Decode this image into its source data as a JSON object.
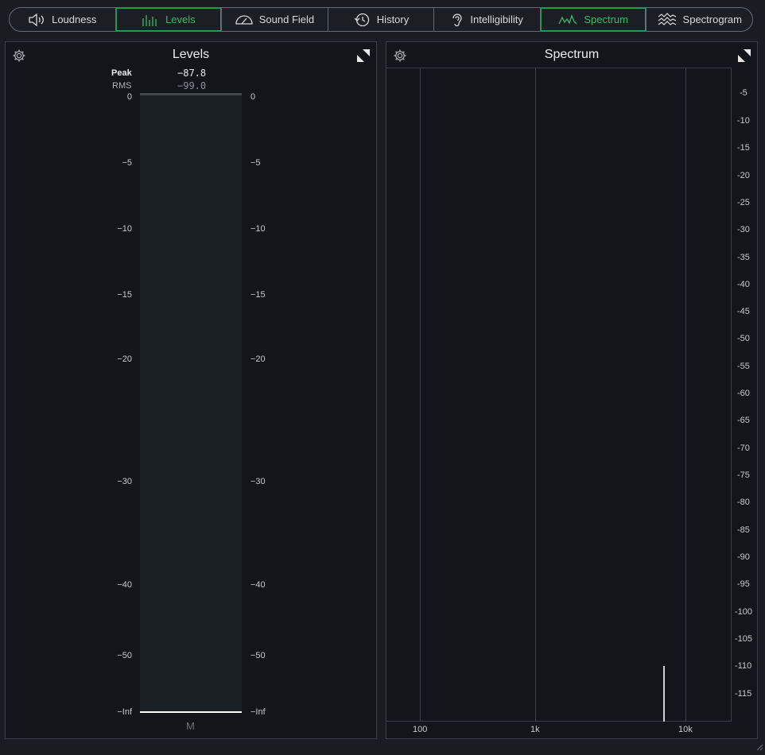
{
  "tabs": [
    {
      "label": "Loudness",
      "icon": "speaker-icon",
      "active": false
    },
    {
      "label": "Levels",
      "icon": "level-bars-icon",
      "active": true
    },
    {
      "label": "Sound Field",
      "icon": "sound-field-icon",
      "active": false
    },
    {
      "label": "History",
      "icon": "history-clock-icon",
      "active": false
    },
    {
      "label": "Intelligibility",
      "icon": "ear-icon",
      "active": false
    },
    {
      "label": "Spectrum",
      "icon": "spectrum-wave-icon",
      "active": true
    },
    {
      "label": "Spectrogram",
      "icon": "spectrogram-icon",
      "active": false
    }
  ],
  "levels": {
    "title": "Levels",
    "peak_label": "Peak",
    "peak_value": "−87.8",
    "rms_label": "RMS",
    "rms_value": "−99.0",
    "scale": [
      "0",
      "−5",
      "−10",
      "−15",
      "−20",
      "−30",
      "−40",
      "−50",
      "−Inf"
    ],
    "channel_label": "M",
    "meter_level_db": -87.8
  },
  "spectrum": {
    "title": "Spectrum",
    "db_scale": [
      "-5",
      "-10",
      "-15",
      "-20",
      "-25",
      "-30",
      "-35",
      "-40",
      "-45",
      "-50",
      "-55",
      "-60",
      "-65",
      "-70",
      "-75",
      "-80",
      "-85",
      "-90",
      "-95",
      "-100",
      "-105",
      "-110",
      "-115"
    ],
    "freq_labels": [
      "100",
      "1k",
      "10k"
    ]
  },
  "colors": {
    "accent": "#3fb866",
    "panel_bg": "#121519",
    "meter_track": "#1b2024"
  }
}
